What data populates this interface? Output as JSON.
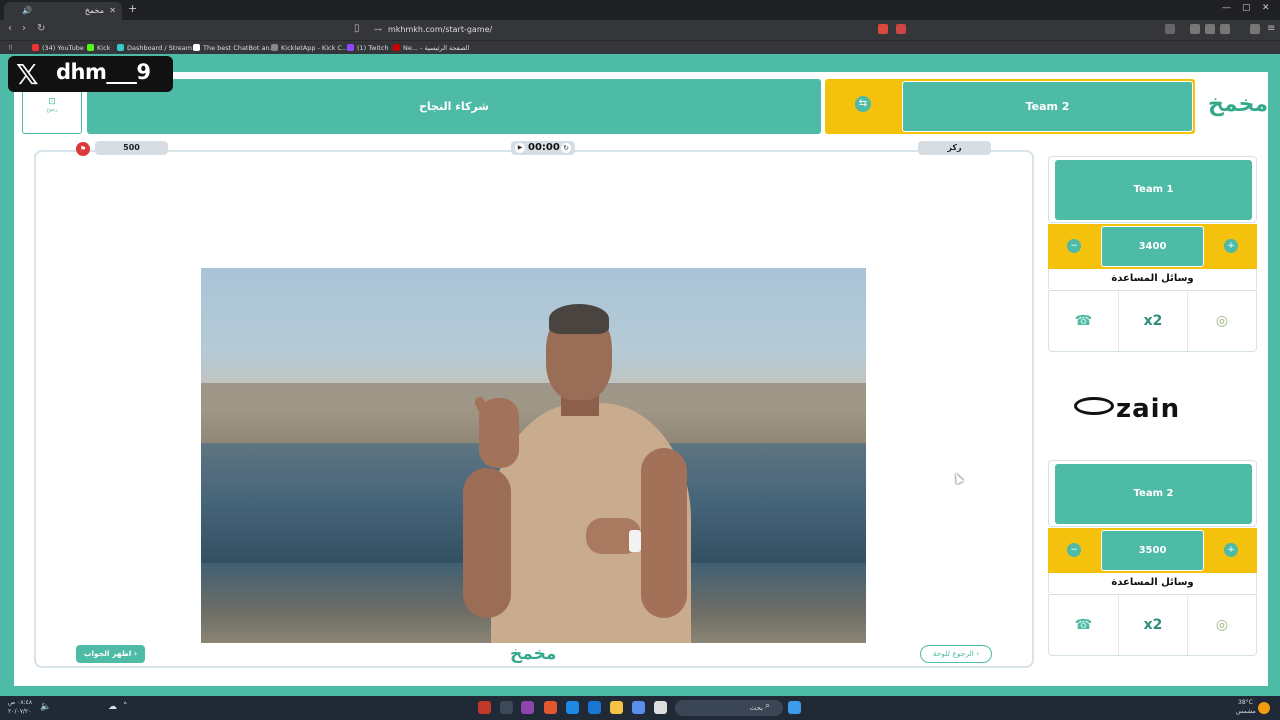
{
  "browser": {
    "tab_title": "مخمخ",
    "url": "mkhmkh.com/start-game/",
    "bookmarks": [
      "(34) YouTube",
      "Kick",
      "Dashboard / Stream...",
      "The best ChatBot an...",
      "KickletApp - Kick C...",
      "(1) Twitch",
      "Ne... - الصفحة الرئيسية"
    ]
  },
  "watermark": {
    "handle": "dhm___9"
  },
  "header": {
    "team1_label": "شركاء النجاح",
    "team2_label": "Team 2",
    "back_label": "رجوع"
  },
  "question": {
    "points": "500",
    "timer": "00:00",
    "category": "ركز",
    "show_answer_label": "اظهر الجواب",
    "back_to_board_label": "الرجوع للوحة"
  },
  "teams": [
    {
      "name": "Team 1",
      "score": "3400",
      "aids_title": "وسائل المساعدة",
      "aids": [
        "phone-a-friend-icon",
        "double-points-icon",
        "pit-icon"
      ]
    },
    {
      "name": "Team 2",
      "score": "3500",
      "aids_title": "وسائل المساعدة",
      "aids": [
        "phone-a-friend-icon",
        "double-points-icon",
        "pit-icon"
      ]
    }
  ],
  "sponsor": {
    "name": "zain"
  },
  "taskbar": {
    "search_placeholder": "بحث",
    "weather_temp": "38°C",
    "weather_text": "مشمس",
    "time": "٠٨:٤٨ ص",
    "date": "٢٠/٠٧/٢٠"
  },
  "colors": {
    "teal": "#4ebba6",
    "yellow": "#f4c20d",
    "accent_red": "#d93a3a"
  }
}
